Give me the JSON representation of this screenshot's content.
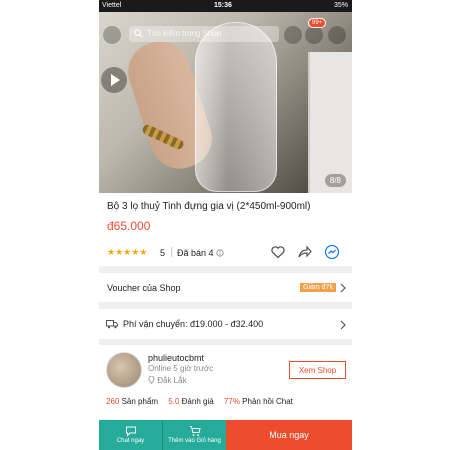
{
  "status_bar": {
    "carrier": "Viettel",
    "time": "15:36",
    "battery": "35%"
  },
  "media": {
    "search_placeholder": "Tìm kiếm trong Shop",
    "cart_badge": "99+",
    "pager": "8/8"
  },
  "product": {
    "title": "Bộ 3 lọ thuỷ Tinh đựng gia vị (2*450ml-900ml)",
    "price": "đ65.000",
    "stars": "★★★★★",
    "rating": "5",
    "sold": "Đã bán 4"
  },
  "voucher": {
    "label": "Voucher của Shop",
    "tag": "Giảm đ7k"
  },
  "shipping": {
    "label": "Phí vận chuyển: đ19.000 - đ32.400"
  },
  "shop": {
    "name": "phulieutocbmt",
    "online": "Online 5 giờ trước",
    "location": "Đắk Lắk",
    "view_button": "Xem Shop",
    "stats": [
      {
        "value": "260",
        "label": "Sản phẩm"
      },
      {
        "value": "5.0",
        "label": "Đánh giá"
      },
      {
        "value": "77%",
        "label": "Phản hồi Chat"
      }
    ]
  },
  "bottom_bar": {
    "chat": "Chat ngay",
    "add_cart": "Thêm vào Giỏ hàng",
    "buy": "Mua ngay"
  },
  "colors": {
    "accent": "#ee4d2d",
    "teal": "#26aa99",
    "star": "#f6a700"
  }
}
